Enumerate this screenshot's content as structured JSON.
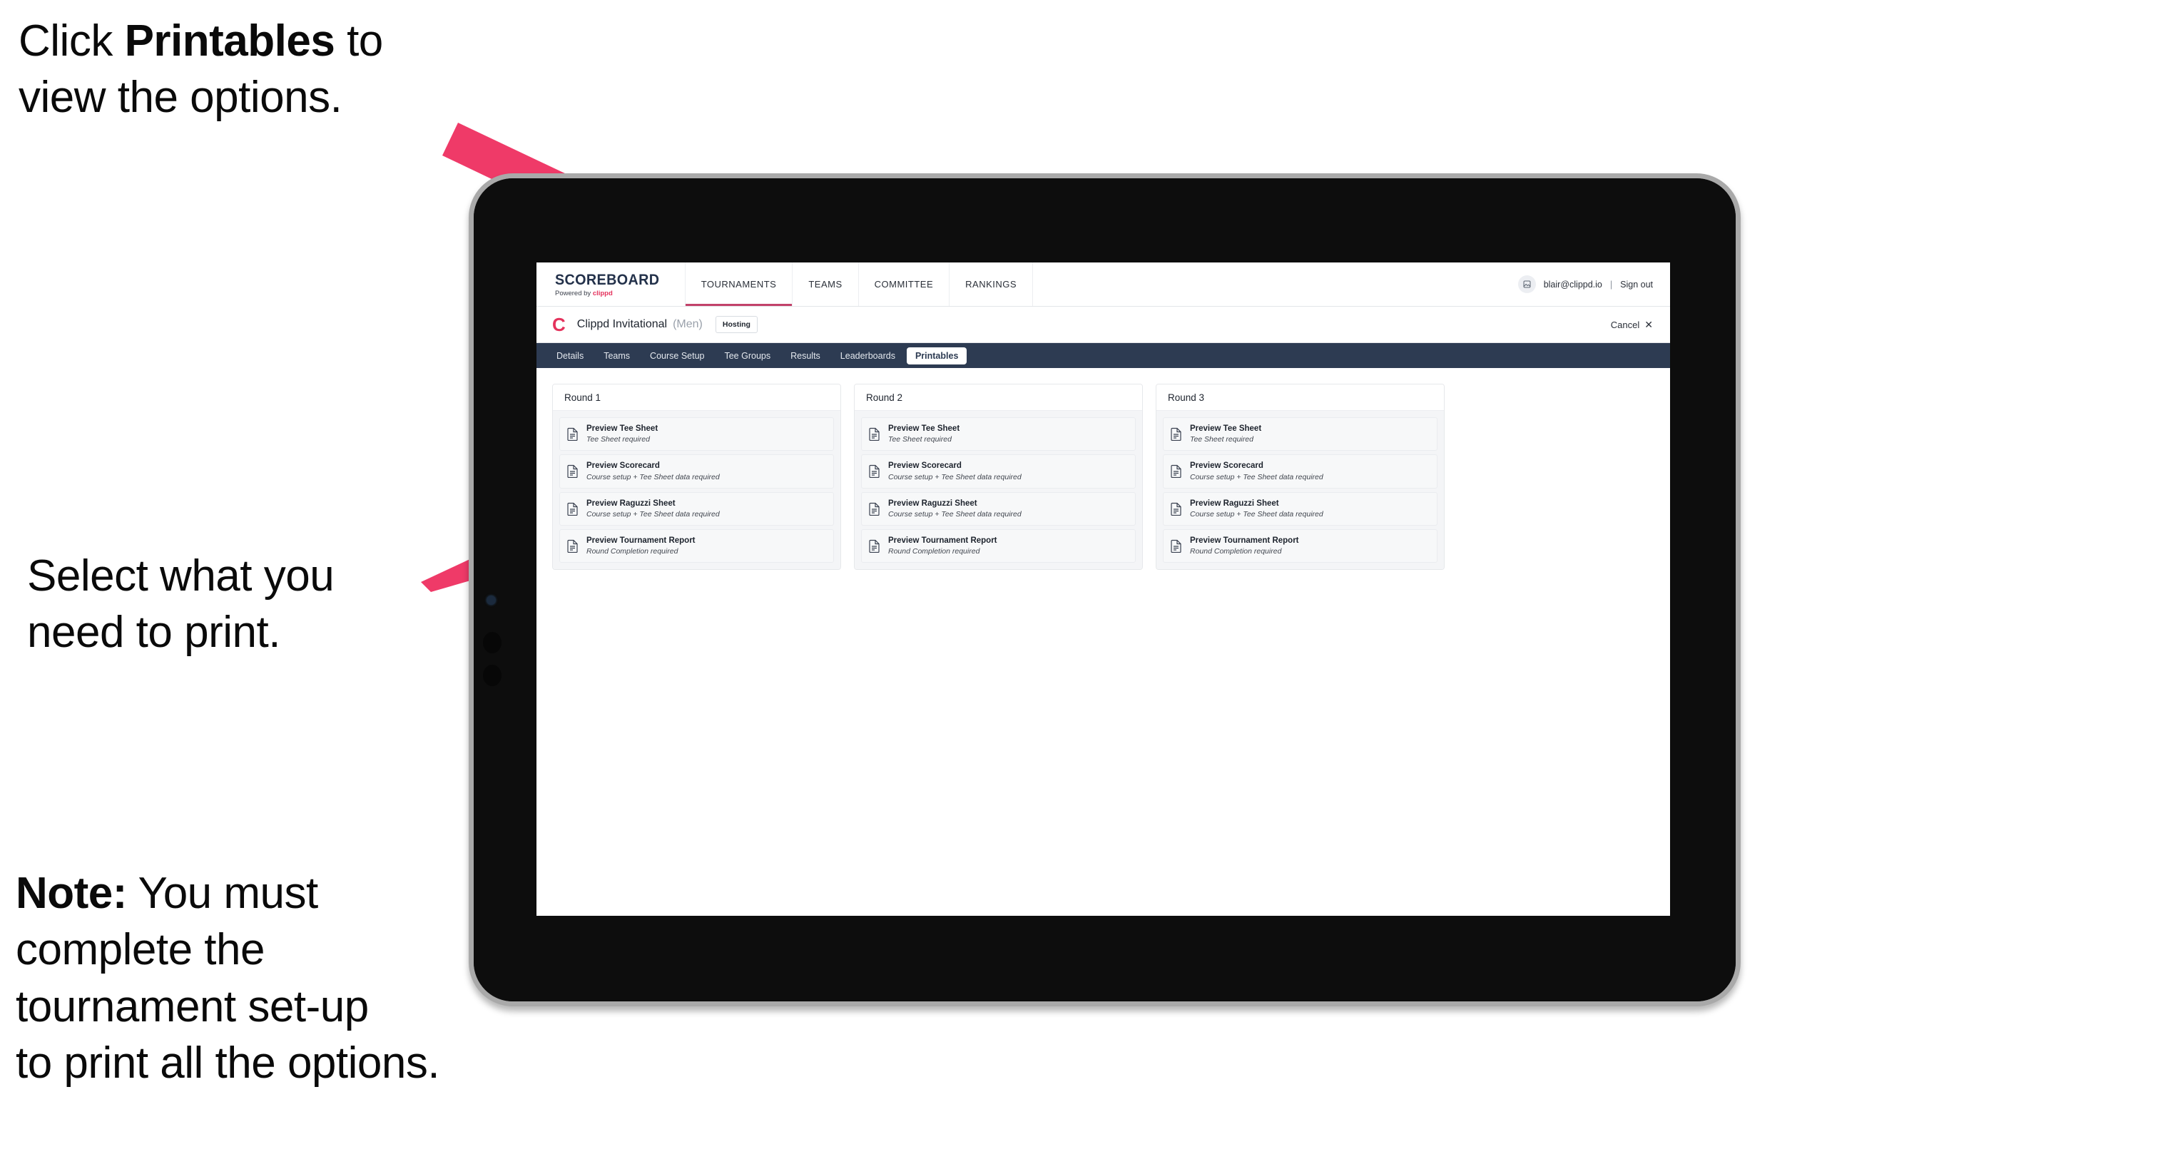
{
  "annotations": [
    {
      "id": "ann-1",
      "prefix": "Click ",
      "bold": "Printables",
      "suffix": " to\nview the options."
    },
    {
      "id": "ann-2",
      "prefix": "Select what you\n need to print.",
      "bold": "",
      "suffix": ""
    },
    {
      "id": "ann-3",
      "prefix": "",
      "bold": "Note:",
      "suffix": " You must\ncomplete the\ntournament set-up\nto print all the options."
    }
  ],
  "colors": {
    "arrow_pink": "#ef3a68",
    "brand_crimson": "#e4325c",
    "tabbar_navy": "#2d3b52",
    "active_underline": "#c2426a"
  },
  "app": {
    "topbar": {
      "logo_main": "SCOREBOARD",
      "logo_sub_prefix": "Powered by ",
      "logo_sub_brand": "clippd",
      "nav": [
        {
          "label": "TOURNAMENTS",
          "active": true
        },
        {
          "label": "TEAMS",
          "active": false
        },
        {
          "label": "COMMITTEE",
          "active": false
        },
        {
          "label": "RANKINGS",
          "active": false
        }
      ],
      "avatar_icon": "user-avatar-icon",
      "user_email": "blair@clippd.io",
      "separator": "|",
      "sign_out": "Sign out"
    },
    "tournament_bar": {
      "logo_letter": "C",
      "title": "Clippd Invitational",
      "gender": "(Men)",
      "badge": "Hosting",
      "cancel_label": "Cancel",
      "cancel_icon": "✕"
    },
    "tabs": [
      {
        "label": "Details",
        "active": false
      },
      {
        "label": "Teams",
        "active": false
      },
      {
        "label": "Course Setup",
        "active": false
      },
      {
        "label": "Tee Groups",
        "active": false
      },
      {
        "label": "Results",
        "active": false
      },
      {
        "label": "Leaderboards",
        "active": false
      },
      {
        "label": "Printables",
        "active": true
      }
    ],
    "rounds": [
      {
        "title": "Round 1",
        "items": [
          {
            "title": "Preview Tee Sheet",
            "sub": "Tee Sheet required"
          },
          {
            "title": "Preview Scorecard",
            "sub": "Course setup + Tee Sheet data required"
          },
          {
            "title": "Preview Raguzzi Sheet",
            "sub": "Course setup + Tee Sheet data required"
          },
          {
            "title": "Preview Tournament Report",
            "sub": "Round Completion required"
          }
        ]
      },
      {
        "title": "Round 2",
        "items": [
          {
            "title": "Preview Tee Sheet",
            "sub": "Tee Sheet required"
          },
          {
            "title": "Preview Scorecard",
            "sub": "Course setup + Tee Sheet data required"
          },
          {
            "title": "Preview Raguzzi Sheet",
            "sub": "Course setup + Tee Sheet data required"
          },
          {
            "title": "Preview Tournament Report",
            "sub": "Round Completion required"
          }
        ]
      },
      {
        "title": "Round 3",
        "items": [
          {
            "title": "Preview Tee Sheet",
            "sub": "Tee Sheet required"
          },
          {
            "title": "Preview Scorecard",
            "sub": "Course setup + Tee Sheet data required"
          },
          {
            "title": "Preview Raguzzi Sheet",
            "sub": "Course setup + Tee Sheet data required"
          },
          {
            "title": "Preview Tournament Report",
            "sub": "Round Completion required"
          }
        ]
      }
    ]
  }
}
